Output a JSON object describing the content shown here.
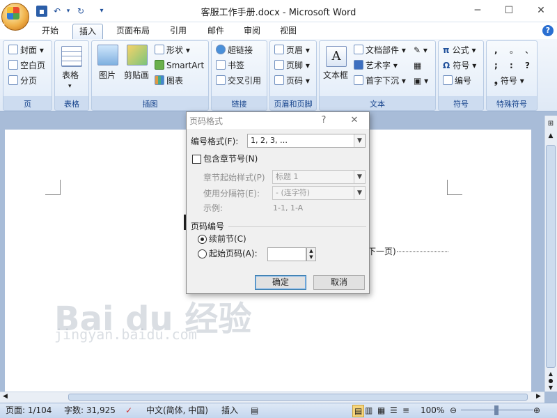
{
  "app": {
    "title": "客服工作手册.docx - Microsoft Word"
  },
  "tabs": [
    "开始",
    "插入",
    "页面布局",
    "引用",
    "邮件",
    "审阅",
    "视图"
  ],
  "active_tab": "插入",
  "ribbon": {
    "page_group": {
      "label": "页",
      "items": [
        "封面",
        "空白页",
        "分页"
      ]
    },
    "table_group": {
      "label": "表格",
      "button": "表格"
    },
    "illustration_group": {
      "label": "插图",
      "picture": "图片",
      "clipart": "剪贴画",
      "shapes": "形状",
      "smartart": "SmartArt",
      "chart": "图表"
    },
    "links_group": {
      "label": "链接",
      "items": [
        "超链接",
        "书签",
        "交叉引用"
      ]
    },
    "header_footer_group": {
      "label": "页眉和页脚",
      "items": [
        "页眉",
        "页脚",
        "页码"
      ]
    },
    "text_group": {
      "label": "文本",
      "textbox": "文本框",
      "items": [
        "文档部件",
        "艺术字",
        "首字下沉"
      ]
    },
    "symbols_group": {
      "label": "符号",
      "items": [
        "公式",
        "符号",
        "编号"
      ]
    },
    "special_group": {
      "label": "特殊符号",
      "chars": [
        ",",
        "。",
        "、",
        ";",
        ":",
        "?"
      ],
      "symbol": "符号"
    }
  },
  "document": {
    "visible_text": "下一页)"
  },
  "watermark": {
    "line1": "Bai du 经验",
    "line2": "jingyan.baidu.com"
  },
  "dialog": {
    "title": "页码格式",
    "help": "?",
    "number_format_label": "编号格式(F):",
    "number_format_value": "1, 2, 3, …",
    "include_chapter_label": "包含章节号(N)",
    "chapter_style_label": "章节起始样式(P)",
    "chapter_style_value": "标题 1",
    "separator_label": "使用分隔符(E):",
    "separator_value": "-  (连字符)",
    "example_label": "示例:",
    "example_value": "1-1, 1-A",
    "numbering_section": "页码编号",
    "continue_label": "续前节(C)",
    "start_at_label": "起始页码(A):",
    "start_at_value": "",
    "ok": "确定",
    "cancel": "取消"
  },
  "status": {
    "page": "页面: 1/104",
    "words": "字数: 31,925",
    "language": "中文(简体, 中国)",
    "mode": "插入",
    "zoom": "100%"
  }
}
